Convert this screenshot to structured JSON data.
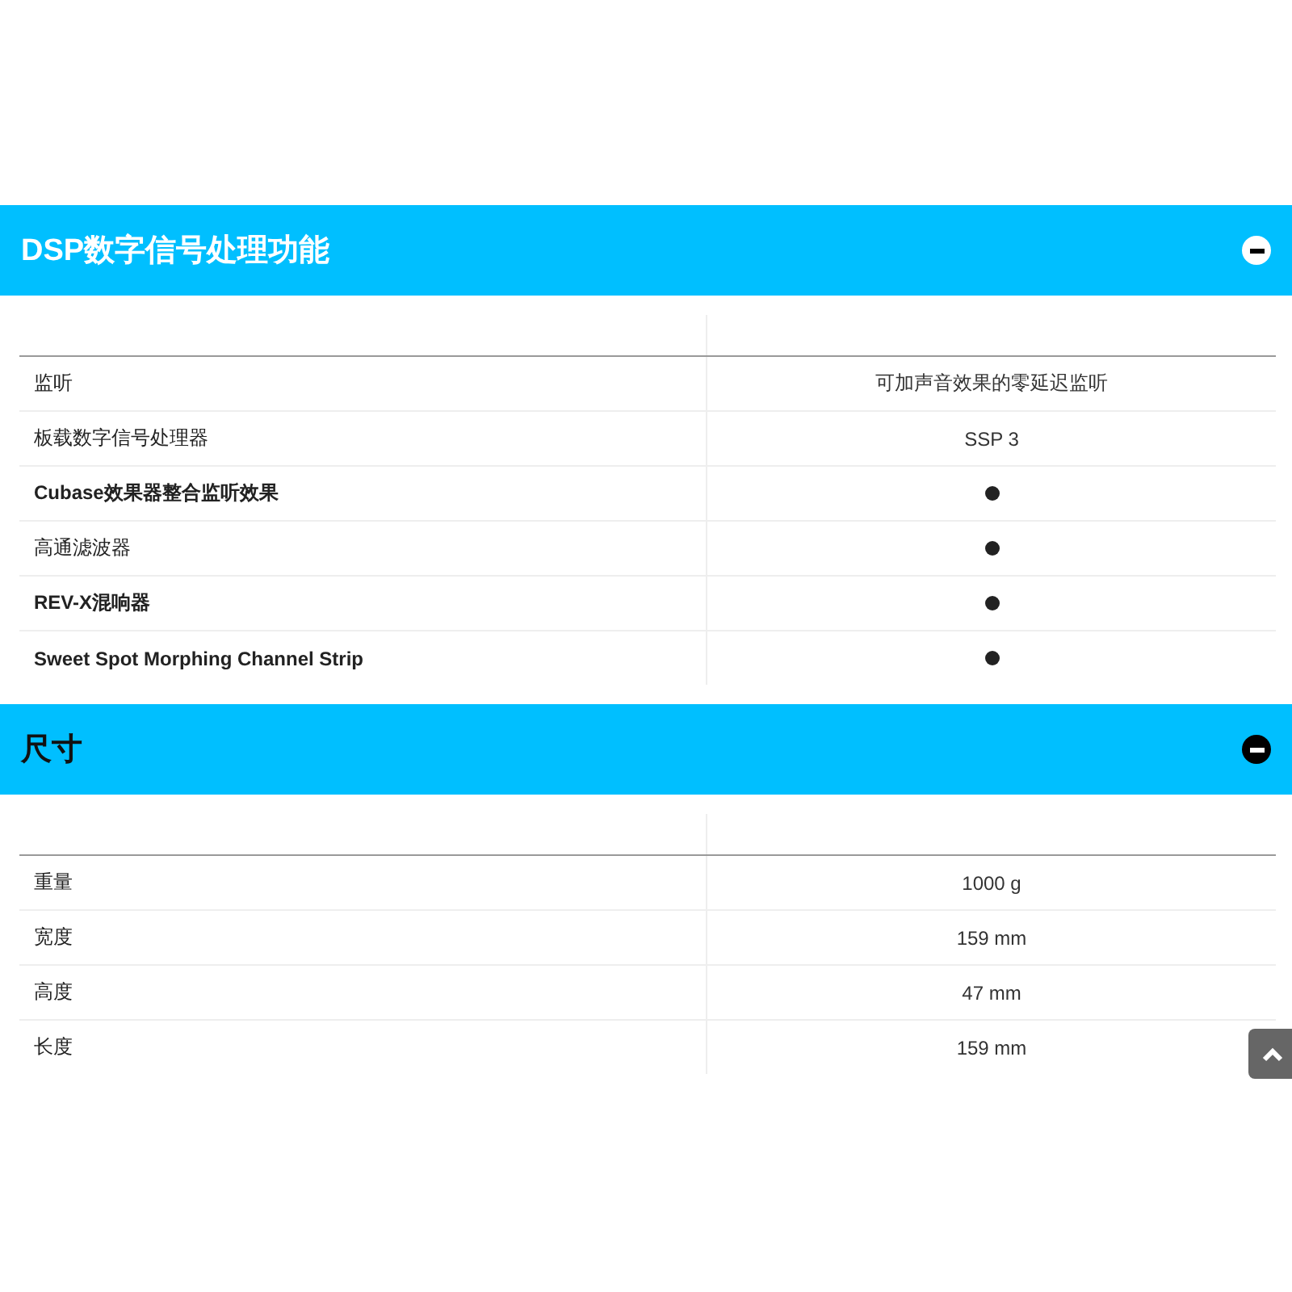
{
  "sections": [
    {
      "title": "DSP数字信号处理功能",
      "kind": "light",
      "expanded": true,
      "rows": [
        {
          "label": "监听",
          "label_bold": false,
          "kind": "text",
          "value": "可加声音效果的零延迟监听"
        },
        {
          "label": "板载数字信号处理器",
          "label_bold": false,
          "kind": "text",
          "value": "SSP 3"
        },
        {
          "label": "Cubase效果器整合监听效果",
          "label_bold": true,
          "kind": "dot"
        },
        {
          "label": "高通滤波器",
          "label_bold": false,
          "kind": "dot"
        },
        {
          "label": "REV-X混响器",
          "label_bold": true,
          "kind": "dot"
        },
        {
          "label": "Sweet Spot Morphing Channel Strip",
          "label_bold": true,
          "kind": "dot"
        }
      ]
    },
    {
      "title": "尺寸",
      "kind": "dark",
      "expanded": true,
      "rows": [
        {
          "label": "重量",
          "label_bold": false,
          "kind": "text",
          "value": "1000 g"
        },
        {
          "label": "宽度",
          "label_bold": false,
          "kind": "text",
          "value": "159 mm"
        },
        {
          "label": "高度",
          "label_bold": false,
          "kind": "text",
          "value": "47 mm"
        },
        {
          "label": "长度",
          "label_bold": false,
          "kind": "text",
          "value": "159 mm"
        }
      ]
    }
  ]
}
